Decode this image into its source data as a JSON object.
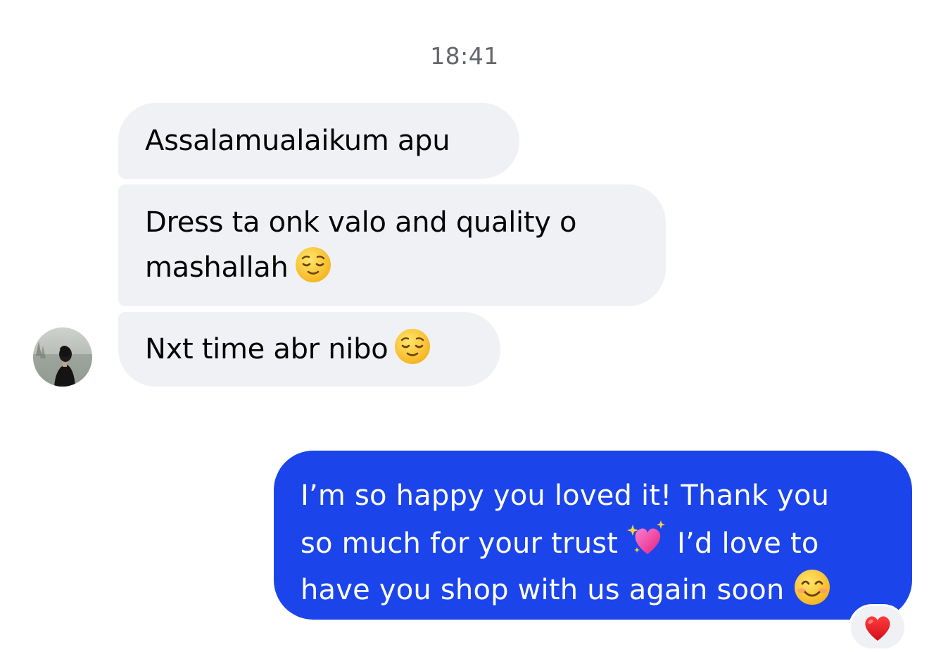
{
  "chat": {
    "timestamp": "18:41",
    "incoming": [
      {
        "text": "Assalamualaikum apu"
      },
      {
        "line1": "Dress ta onk valo and quality o",
        "line2": "mashallah",
        "emoji": "relieved-face"
      },
      {
        "text": "Nxt time abr nibo",
        "emoji": "relieved-face"
      }
    ],
    "outgoing": {
      "line1": "I’m so happy you loved it! Thank you",
      "line2_a": "so much for your trust",
      "line2_emoji": "sparkling-heart",
      "line2_b": "I’d love to",
      "line3": "have you shop with us again soon",
      "line3_emoji": "smiling-face-with-smiling-eyes",
      "color": "#1b45eb"
    },
    "reaction": {
      "emoji": "red-heart",
      "color": "#e0121b"
    },
    "incoming_bubble_color": "#f0f1f5"
  }
}
